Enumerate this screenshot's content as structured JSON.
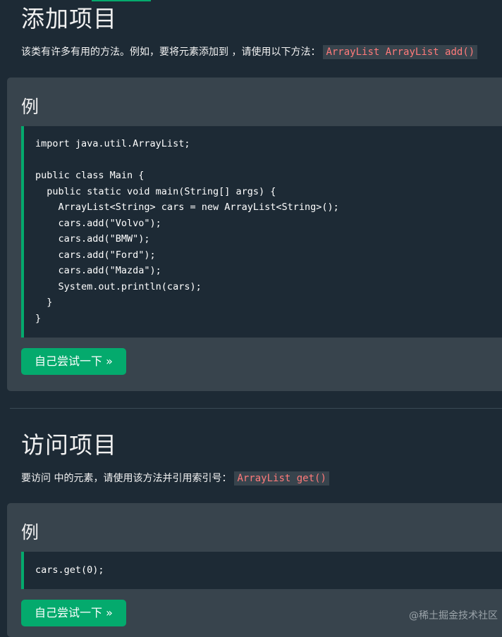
{
  "section1": {
    "title": "添加项目",
    "intro_text": "该类有许多有用的方法。例如，要将元素添加到 ，请使用以下方法：",
    "intro_code": "ArrayList ArrayList add()",
    "example_label": "例",
    "code_lines": [
      "import java.util.ArrayList;",
      "",
      "public class Main {",
      "  public static void main(String[] args) {",
      "    ArrayList<String> cars = new ArrayList<String>();",
      "    cars.add(\"Volvo\");",
      "    cars.add(\"BMW\");",
      "    cars.add(\"Ford\");",
      "    cars.add(\"Mazda\");",
      "    System.out.println(cars);",
      "  }",
      "}"
    ],
    "try_button": "自己尝试一下 »"
  },
  "section2": {
    "title": "访问项目",
    "intro_text": "要访问 中的元素，请使用该方法并引用索引号：",
    "intro_code": "ArrayList get()",
    "example_label": "例",
    "code_lines": [
      "cars.get(0);"
    ],
    "try_button": "自己尝试一下 »"
  },
  "watermark": "@稀土掘金技术社区",
  "colors": {
    "background": "#1d2a35",
    "panel": "#38444d",
    "accent": "#04aa6d",
    "inline_code": "#ff7a7a"
  }
}
